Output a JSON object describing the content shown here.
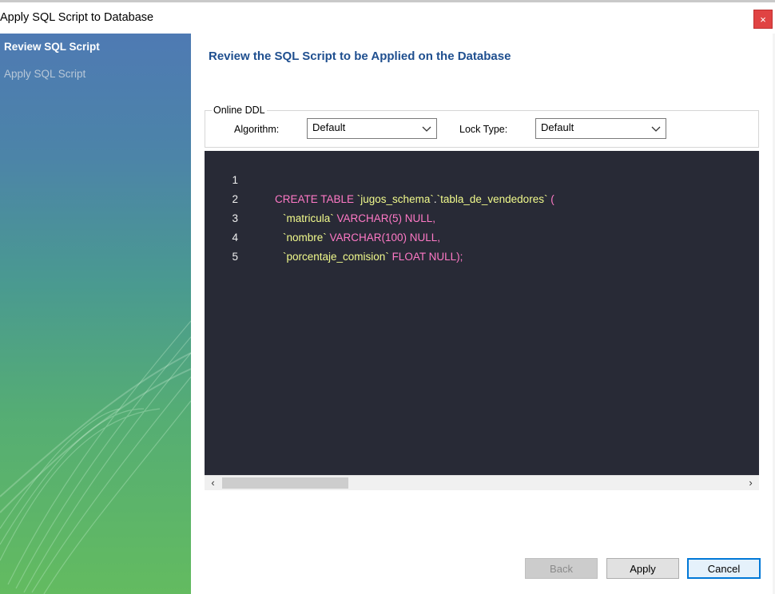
{
  "window": {
    "title": "Apply SQL Script to Database",
    "close_label": "×"
  },
  "sidebar": {
    "steps": [
      {
        "label": "Review SQL Script",
        "state": "active"
      },
      {
        "label": "Apply SQL Script",
        "state": "pending"
      }
    ]
  },
  "main": {
    "heading": "Review the SQL Script to be Applied on the Database",
    "online_ddl": {
      "legend": "Online DDL",
      "algorithm_label": "Algorithm:",
      "algorithm_value": "Default",
      "lock_type_label": "Lock Type:",
      "lock_type_value": "Default"
    },
    "editor": {
      "lines": [
        {
          "num": "1",
          "tokens": [
            "CREATE TABLE ",
            "`jugos_schema`",
            ".",
            "`tabla_de_vendedores`",
            " ("
          ]
        },
        {
          "num": "2",
          "tokens": [
            "`matricula`",
            " VARCHAR(5) NULL,"
          ]
        },
        {
          "num": "3",
          "tokens": [
            "`nombre`",
            " VARCHAR(100) NULL,"
          ]
        },
        {
          "num": "4",
          "tokens": [
            "`porcentaje_comision`",
            " FLOAT NULL);"
          ]
        },
        {
          "num": "5"
        }
      ]
    },
    "buttons": {
      "back": "Back",
      "apply": "Apply",
      "cancel": "Cancel"
    }
  },
  "colors": {
    "accent": "#0078d7",
    "heading": "#1f4f8f",
    "editor_bg": "#282a36",
    "keyword": "#ff79c6",
    "string": "#f1fa8c",
    "close_button": "#e04343"
  }
}
